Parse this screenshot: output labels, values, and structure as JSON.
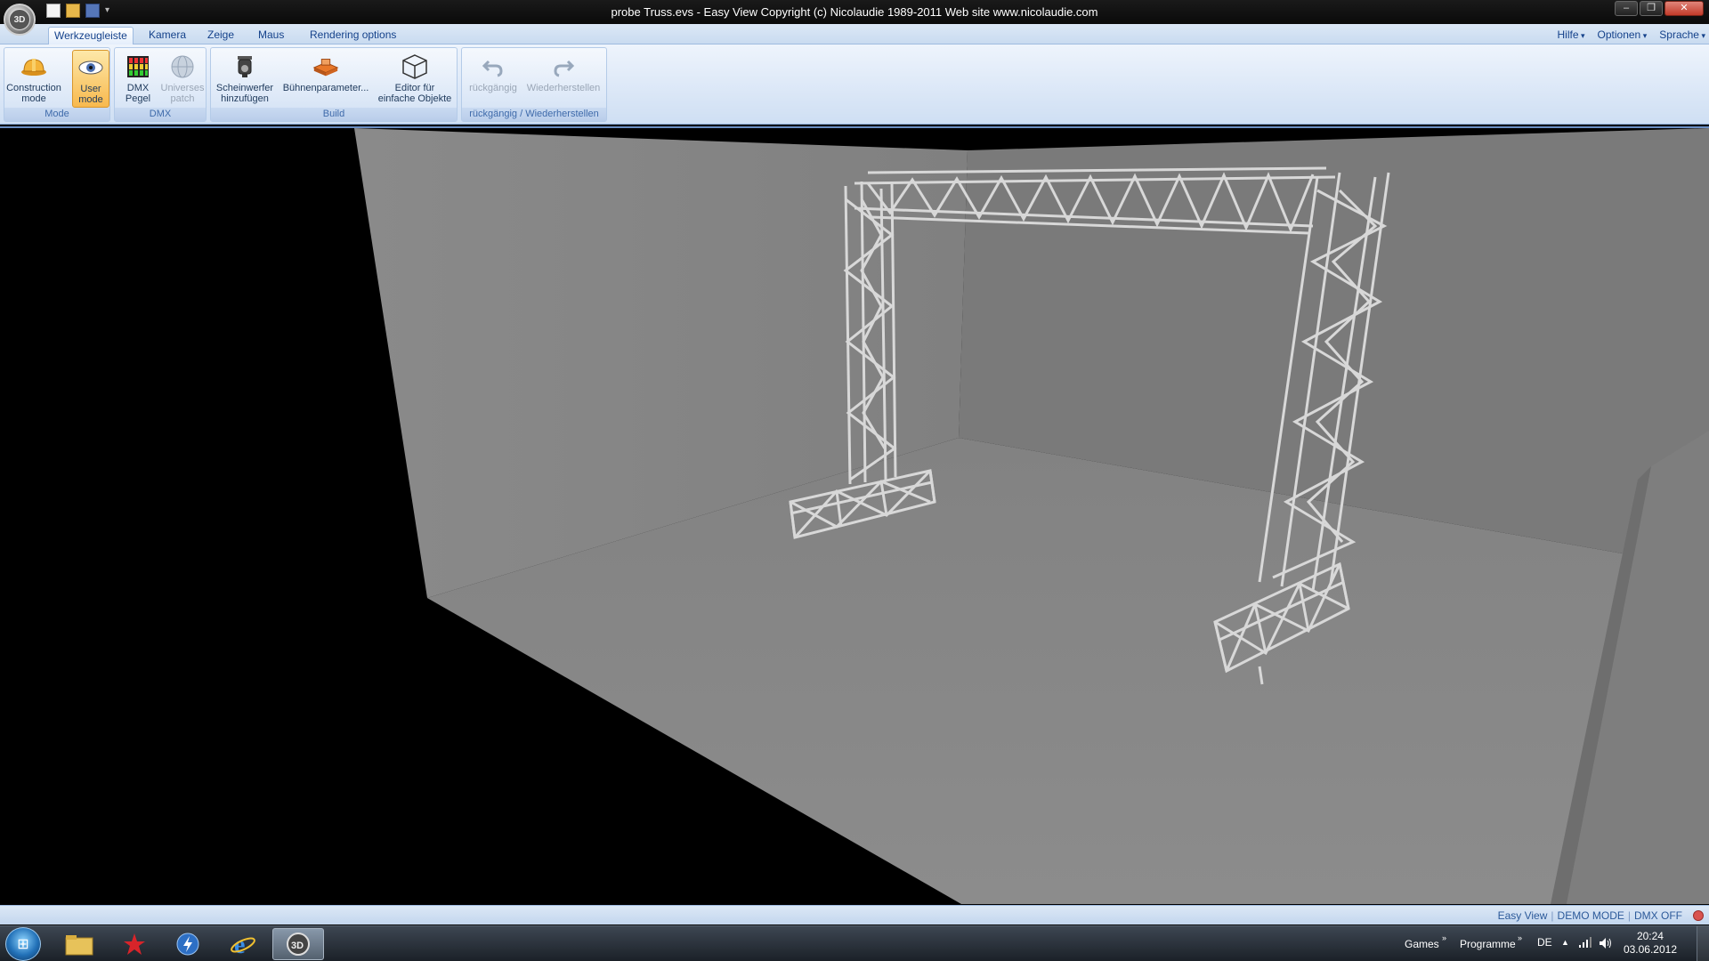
{
  "title_bar": {
    "title": "probe Truss.evs - Easy View   Copyright (c) Nicolaudie 1989-2011    Web site www.nicolaudie.com",
    "orb_label": "3D"
  },
  "tabs": [
    {
      "label": "Werkzeugleiste",
      "active": true
    },
    {
      "label": "Kamera",
      "active": false
    },
    {
      "label": "Zeige",
      "active": false
    },
    {
      "label": "Maus",
      "active": false
    },
    {
      "label": "Rendering options",
      "active": false
    }
  ],
  "right_menus": {
    "help": "Hilfe",
    "options": "Optionen",
    "language": "Sprache"
  },
  "ribbon": {
    "groups": {
      "mode": "Mode",
      "dmx": "DMX",
      "build": "Build",
      "undo": "rückgängig / Wiederherstellen"
    },
    "buttons": {
      "construction_mode": "Construction\nmode",
      "user_mode": "User\nmode",
      "dmx_pegel": "DMX\nPegel",
      "universes_patch": "Universes\npatch",
      "scheinwerfer": "Scheinwerfer\nhinzufügen",
      "buehnenparameter": "Bühnenparameter...",
      "editor": "Editor für\neinfache Objekte",
      "undo": "rückgängig",
      "redo": "Wiederherstellen"
    }
  },
  "status_bar": {
    "view": "Easy View",
    "mode": "DEMO MODE",
    "dmx": "DMX OFF"
  },
  "taskbar": {
    "games": "Games",
    "programme": "Programme",
    "language": "DE",
    "time": "20:24",
    "date": "03.06.2012"
  },
  "colors": {
    "ribbon_bg": "#dbe7f7",
    "accent": "#15428b",
    "active_button": "#f8b94e"
  }
}
